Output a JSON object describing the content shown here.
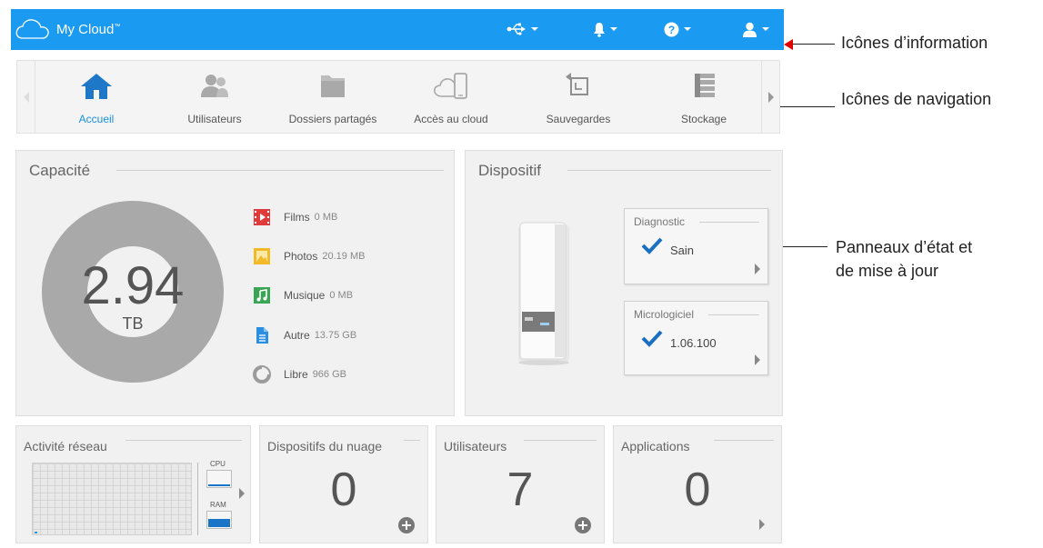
{
  "header": {
    "brand": "My Cloud",
    "trademark": "™",
    "bg_color": "#1a9af0",
    "icons": [
      "usb-icon",
      "bell-icon",
      "help-icon",
      "user-icon"
    ]
  },
  "annotations": {
    "info_icons": "Icônes d’information",
    "nav_icons": "Icônes de navigation",
    "status_panels_line1": "Panneaux d’état et",
    "status_panels_line2": "de mise à jour",
    "arrow_color": "#e00000"
  },
  "nav": {
    "items": [
      {
        "label": "Accueil",
        "icon": "home-icon",
        "active": true
      },
      {
        "label": "Utilisateurs",
        "icon": "users-icon"
      },
      {
        "label": "Dossiers partagés",
        "icon": "folder-icon"
      },
      {
        "label": "Accès au cloud",
        "icon": "cloud-device-icon"
      },
      {
        "label": "Sauvegardes",
        "icon": "backup-icon"
      },
      {
        "label": "Stockage",
        "icon": "storage-icon"
      }
    ],
    "active_color": "#1a8fe0"
  },
  "capacity": {
    "title": "Capacité",
    "value": "2.94",
    "unit": "TB",
    "legend": [
      {
        "name": "Films",
        "value": "0 MB",
        "icon": "film-icon",
        "color": "#e03b3b"
      },
      {
        "name": "Photos",
        "value": "20.19 MB",
        "icon": "photo-icon",
        "color": "#f2b928"
      },
      {
        "name": "Musique",
        "value": "0 MB",
        "icon": "music-icon",
        "color": "#3aa655"
      },
      {
        "name": "Autre",
        "value": "13.75 GB",
        "icon": "document-icon",
        "color": "#2a8fe0"
      },
      {
        "name": "Libre",
        "value": "966 GB",
        "icon": "pie-icon",
        "color": "#9b9b9b"
      }
    ]
  },
  "device": {
    "title": "Dispositif",
    "diagnostic": {
      "title": "Diagnostic",
      "value": "Sain"
    },
    "firmware": {
      "title": "Micrologiciel",
      "value": "1.06.100"
    }
  },
  "network": {
    "title": "Activité réseau",
    "cpu_label": "CPU",
    "ram_label": "RAM",
    "cpu_level": 0.1,
    "ram_level": 0.55
  },
  "cloud_devices": {
    "title": "Dispositifs du nuage",
    "count": "0"
  },
  "users": {
    "title": "Utilisateurs",
    "count": "7"
  },
  "apps": {
    "title": "Applications",
    "count": "0"
  }
}
